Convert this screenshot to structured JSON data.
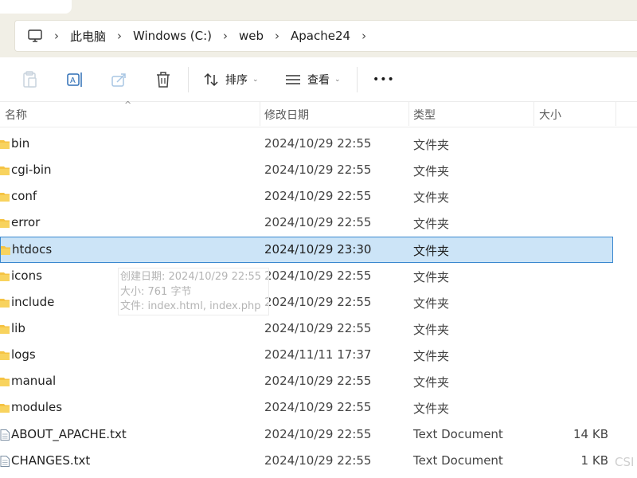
{
  "breadcrumb": [
    "此电脑",
    "Windows (C:)",
    "web",
    "Apache24"
  ],
  "toolbar": {
    "sort_label": "排序",
    "view_label": "查看",
    "more_label": "•••"
  },
  "columns": {
    "name": "名称",
    "date": "修改日期",
    "type": "类型",
    "size": "大小"
  },
  "rows": [
    {
      "name": "bin",
      "date": "2024/10/29 22:55",
      "type": "文件夹",
      "size": "",
      "kind": "folder"
    },
    {
      "name": "cgi-bin",
      "date": "2024/10/29 22:55",
      "type": "文件夹",
      "size": "",
      "kind": "folder"
    },
    {
      "name": "conf",
      "date": "2024/10/29 22:55",
      "type": "文件夹",
      "size": "",
      "kind": "folder"
    },
    {
      "name": "error",
      "date": "2024/10/29 22:55",
      "type": "文件夹",
      "size": "",
      "kind": "folder"
    },
    {
      "name": "htdocs",
      "date": "2024/10/29 23:30",
      "type": "文件夹",
      "size": "",
      "kind": "folder",
      "selected": true
    },
    {
      "name": "icons",
      "date": "2024/10/29 22:55",
      "type": "文件夹",
      "size": "",
      "kind": "folder"
    },
    {
      "name": "include",
      "date": "2024/10/29 22:55",
      "type": "文件夹",
      "size": "",
      "kind": "folder"
    },
    {
      "name": "lib",
      "date": "2024/10/29 22:55",
      "type": "文件夹",
      "size": "",
      "kind": "folder"
    },
    {
      "name": "logs",
      "date": "2024/11/11 17:37",
      "type": "文件夹",
      "size": "",
      "kind": "folder"
    },
    {
      "name": "manual",
      "date": "2024/10/29 22:55",
      "type": "文件夹",
      "size": "",
      "kind": "folder"
    },
    {
      "name": "modules",
      "date": "2024/10/29 22:55",
      "type": "文件夹",
      "size": "",
      "kind": "folder"
    },
    {
      "name": "ABOUT_APACHE.txt",
      "date": "2024/10/29 22:55",
      "type": "Text Document",
      "size": "14 KB",
      "kind": "file"
    },
    {
      "name": "CHANGES.txt",
      "date": "2024/10/29 22:55",
      "type": "Text Document",
      "size": "1 KB",
      "kind": "file"
    }
  ],
  "tooltip": {
    "created": "创建日期: 2024/10/29 22:55",
    "size": "大小: 761 字节",
    "files": "文件: index.html, index.php"
  },
  "watermark": "CSI",
  "colors": {
    "chrome_bg": "#f1efe6",
    "selection_bg": "#cce4f7",
    "selection_border": "#3a88cf",
    "folder": "#f5c343"
  }
}
